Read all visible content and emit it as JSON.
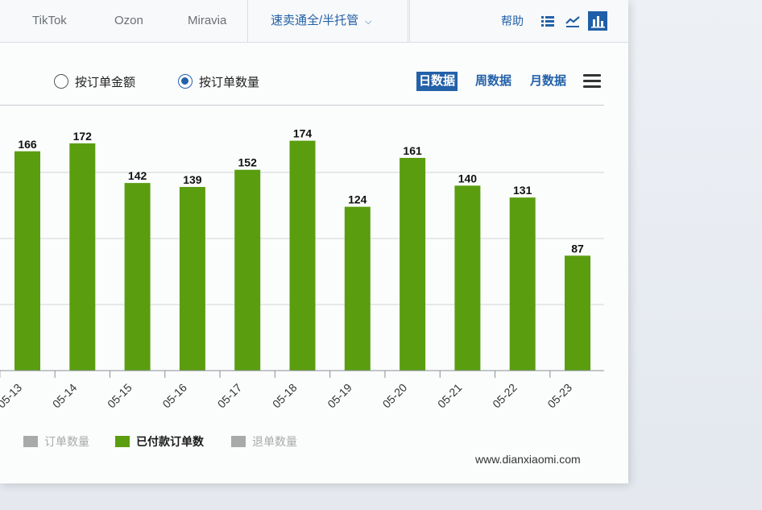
{
  "nav": {
    "tabs": [
      "TikTok",
      "Ozon",
      "Miravia"
    ],
    "selected_platform": "速卖通全/半托管",
    "help_label": "帮助",
    "icons": [
      "list-icon",
      "line-chart-icon",
      "bar-chart-icon"
    ]
  },
  "controls": {
    "radio_amount_label": "按订单金额",
    "radio_count_label": "按订单数量",
    "selected_radio": "按订单数量",
    "periods": [
      "日数据",
      "周数据",
      "月数据"
    ],
    "selected_period": "日数据"
  },
  "chart_data": {
    "type": "bar",
    "categories": [
      "05-13",
      "05-14",
      "05-15",
      "05-16",
      "05-17",
      "05-18",
      "05-19",
      "05-20",
      "05-21",
      "05-22",
      "05-23"
    ],
    "series": [
      {
        "name": "已付款订单数",
        "values": [
          166,
          172,
          142,
          139,
          152,
          174,
          124,
          161,
          140,
          131,
          87
        ],
        "color": "#5a9e10"
      }
    ],
    "ylim": [
      0,
      200
    ],
    "grid": true,
    "data_labels": true
  },
  "legend": {
    "items": [
      {
        "label": "订单数量",
        "color": "#a9a9a9",
        "active": false
      },
      {
        "label": "已付款订单数",
        "color": "#5a9e10",
        "active": true
      },
      {
        "label": "退单数量",
        "color": "#a9a9a9",
        "active": false
      }
    ]
  },
  "watermark": "www.dianxiaomi.com",
  "colors": {
    "accent": "#2361a8",
    "bar": "#5a9e10",
    "inactive": "#a9a9a9"
  }
}
